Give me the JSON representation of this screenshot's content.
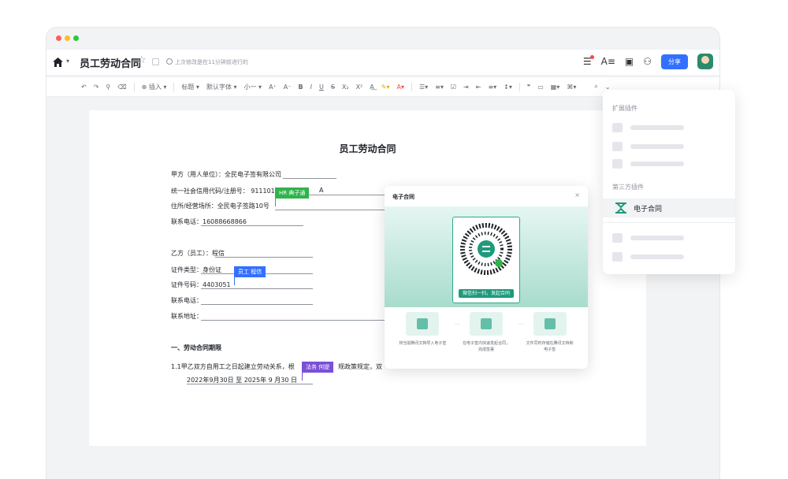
{
  "app": {
    "doc_title": "员工劳动合同",
    "saved_status": "上次修改是在11分钟前进行的",
    "share_label": "分享"
  },
  "toolbar": {
    "insert": "插入",
    "heading": "标题",
    "font": "默认字体",
    "size": "小一"
  },
  "document": {
    "title": "员工劳动合同",
    "party_a": "甲方（用人单位）：全民电子签有限公司",
    "credit_code": "统一社会信用代码/注册号： 911101",
    "credit_code_suffix": "A",
    "address": "住所/经营场所：全民电子签路10号",
    "phone_a": "联系电话：16088668866",
    "party_b": "乙方（员工）：程信",
    "id_type": "证件类型：身份证",
    "id_no": "证件号码：4403051",
    "phone_b": "联系电话：",
    "address_b": "联系地址：",
    "section1": "一、劳动合同期限",
    "clause1": "1.1甲乙双方自用工之日起建立劳动关系，根",
    "clause1_tail": "规政策规定，双",
    "date_range": "2022年9月30日 至 2025年 9 月30 日"
  },
  "collaborators": [
    {
      "label": "HR 典子通",
      "color": "#2fb44a"
    },
    {
      "label": "员工 程信",
      "color": "#3370ff"
    },
    {
      "label": "法务 何提",
      "color": "#7b4fd6"
    }
  ],
  "modal": {
    "title": "电子合同",
    "close": "×",
    "qr_button": "微信扫一扫，发起合同",
    "steps": [
      {
        "text": "将当前腾讯文档导入电子签"
      },
      {
        "text": "在电子签内快速发起合同，完成签署"
      },
      {
        "text": "文件同时存储在腾讯文档和电子签"
      }
    ]
  },
  "panel": {
    "heading1": "扩展插件",
    "heading2": "第三方插件",
    "plugin_label": "电子合同",
    "accent": "#1e9b7c"
  }
}
